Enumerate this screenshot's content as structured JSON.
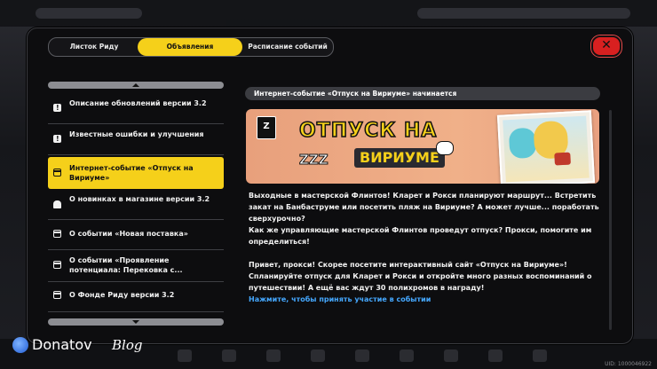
{
  "tabs": [
    {
      "label": "Листок Риду"
    },
    {
      "label": "Объявления"
    },
    {
      "label": "Расписание событий"
    }
  ],
  "close_icon": "close-icon",
  "list_items": [
    {
      "label": "Описание обновлений версии 3.2",
      "icon": "notice-icon"
    },
    {
      "label": "Известные ошибки и улучшения",
      "icon": "notice-icon"
    },
    {
      "label": "Интернет-событие «Отпуск на Вириуме»",
      "icon": "calendar-icon"
    },
    {
      "label": "О новинках в магазине версии 3.2",
      "icon": "bell-icon"
    },
    {
      "label": "О событии «Новая поставка»",
      "icon": "calendar-icon"
    },
    {
      "label": "О событии «Проявление потенциала: Перековка с...",
      "icon": "calendar-icon"
    },
    {
      "label": "О Фонде Риду версии 3.2",
      "icon": "calendar-icon"
    }
  ],
  "article": {
    "title": "Интернет-событие «Отпуск на Вириуме» начинается",
    "banner": {
      "line1": "ОТПУСК НА",
      "line2a": "ZZZ",
      "line2b": "ВИРИУМЕ"
    },
    "p1": "Выходные в мастерской Флинтов! Кларет и Рокси планируют маршрут... Встретить закат на Банбаструме или посетить пляж на Вириуме? А может лучше... поработать сверхурочно?",
    "p2": "Как же управляющие мастерской Флинтов проведут отпуск? Прокси, помогите им определиться!",
    "p3": "Привет, прокси! Скорее посетите интерактивный сайт «Отпуск на Вириуме»! Спланируйте отпуск для Кларет и Рокси и откройте много разных воспоминаний о путешествии! А ещё вас ждут 30 полихромов в награду!",
    "link": "Нажмите, чтобы принять участие в событии"
  },
  "uid": "UID: 1000046922",
  "watermark": {
    "name": "Donatov",
    "suffix": "Blog"
  },
  "colors": {
    "accent": "#f5d01a",
    "close": "#d82020",
    "link": "#45a8ff"
  }
}
